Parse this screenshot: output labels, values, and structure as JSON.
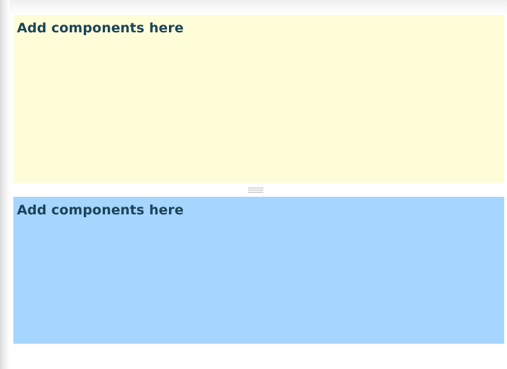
{
  "split_panel": {
    "top_pane": {
      "placeholder": "Add components here",
      "background": "#fefdd8"
    },
    "bottom_pane": {
      "placeholder": "Add components here",
      "background": "#a6d5fe"
    },
    "splitter": {
      "icon": "drag-handle-icon",
      "orientation": "horizontal"
    }
  }
}
